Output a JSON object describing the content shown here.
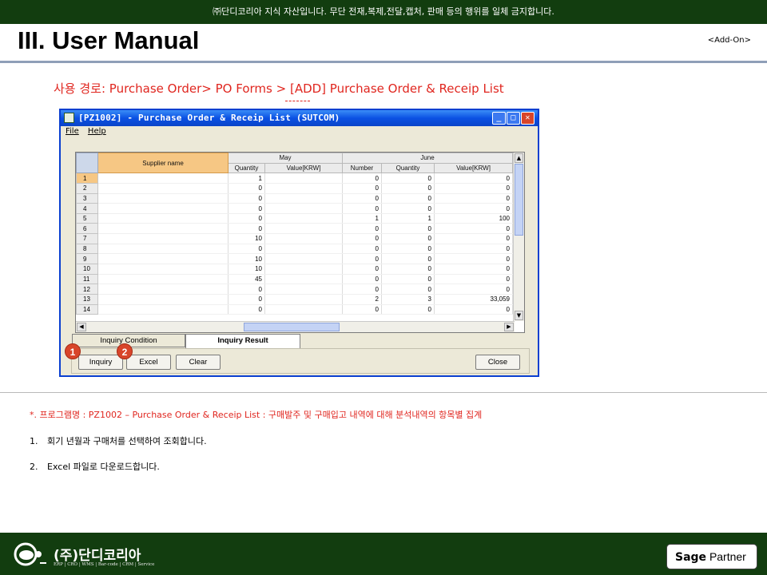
{
  "banner": "㈜단디코리아 지식 자산입니다. 무단 전재,복제,전달,캡처, 판매 등의 행위를 일체 금지합니다.",
  "page_title": "III. User Manual",
  "addon_label": "<Add-On>",
  "path_text": "사용 경로: Purchase Order> PO Forms > [ADD] Purchase Order & Receip List",
  "window": {
    "title": "[PZ1002] - Purchase Order & Receip List (SUTCOM)",
    "menu": [
      "File",
      "Help"
    ],
    "controls": {
      "minimize": "_",
      "maximize": "□",
      "close": "✕"
    },
    "grid": {
      "supplier_header": "Supplier name",
      "groups": [
        {
          "label": "May",
          "columns": [
            "Quantity",
            "Value[KRW]"
          ]
        },
        {
          "label": "June",
          "columns": [
            "Number",
            "Quantity",
            "Value[KRW]"
          ]
        }
      ],
      "rows": [
        {
          "no": "1",
          "may_qty": "1",
          "may_val": "",
          "jun_num": "0",
          "jun_qty": "0",
          "jun_val": "0"
        },
        {
          "no": "2",
          "may_qty": "0",
          "may_val": "",
          "jun_num": "0",
          "jun_qty": "0",
          "jun_val": "0"
        },
        {
          "no": "3",
          "may_qty": "0",
          "may_val": "",
          "jun_num": "0",
          "jun_qty": "0",
          "jun_val": "0"
        },
        {
          "no": "4",
          "may_qty": "0",
          "may_val": "",
          "jun_num": "0",
          "jun_qty": "0",
          "jun_val": "0"
        },
        {
          "no": "5",
          "may_qty": "0",
          "may_val": "",
          "jun_num": "1",
          "jun_qty": "1",
          "jun_val": "100"
        },
        {
          "no": "6",
          "may_qty": "0",
          "may_val": "",
          "jun_num": "0",
          "jun_qty": "0",
          "jun_val": "0"
        },
        {
          "no": "7",
          "may_qty": "10",
          "may_val": "",
          "jun_num": "0",
          "jun_qty": "0",
          "jun_val": "0"
        },
        {
          "no": "8",
          "may_qty": "0",
          "may_val": "",
          "jun_num": "0",
          "jun_qty": "0",
          "jun_val": "0"
        },
        {
          "no": "9",
          "may_qty": "10",
          "may_val": "",
          "jun_num": "0",
          "jun_qty": "0",
          "jun_val": "0"
        },
        {
          "no": "10",
          "may_qty": "10",
          "may_val": "",
          "jun_num": "0",
          "jun_qty": "0",
          "jun_val": "0"
        },
        {
          "no": "11",
          "may_qty": "45",
          "may_val": "",
          "jun_num": "0",
          "jun_qty": "0",
          "jun_val": "0"
        },
        {
          "no": "12",
          "may_qty": "0",
          "may_val": "",
          "jun_num": "0",
          "jun_qty": "0",
          "jun_val": "0"
        },
        {
          "no": "13",
          "may_qty": "0",
          "may_val": "",
          "jun_num": "2",
          "jun_qty": "3",
          "jun_val": "33,059"
        },
        {
          "no": "14",
          "may_qty": "0",
          "may_val": "",
          "jun_num": "0",
          "jun_qty": "0",
          "jun_val": "0"
        }
      ]
    },
    "tabs": [
      "Inquiry Condition",
      "Inquiry Result"
    ],
    "active_tab": "Inquiry Result",
    "buttons": {
      "inquiry": "Inquiry",
      "excel": "Excel",
      "clear": "Clear",
      "close": "Close"
    },
    "badges": [
      "1",
      "2"
    ]
  },
  "description": "*. 프로그램명 : PZ1002 – Purchase Order & Receip List : 구매발주 및 구매입고 내역에 대해 분석내역의 항목별 집계",
  "steps": [
    {
      "num": "1.",
      "text": "회기 년월과 구매처를 선택하여 조회합니다."
    },
    {
      "num": "2.",
      "text": "Excel 파일로 다운로드합니다."
    }
  ],
  "footer": {
    "company": "(주)단디코리아",
    "tagline": "ERP | CRO | WMS | Bar-code | CRM | Service",
    "partner_brand": "Sage",
    "partner_label": "Partner"
  },
  "colors": {
    "banner_bg": "#123d0f",
    "accent_red": "#e0261f",
    "grid_header_orange": "#f6c784",
    "titlebar_blue": "#0b51e3"
  }
}
